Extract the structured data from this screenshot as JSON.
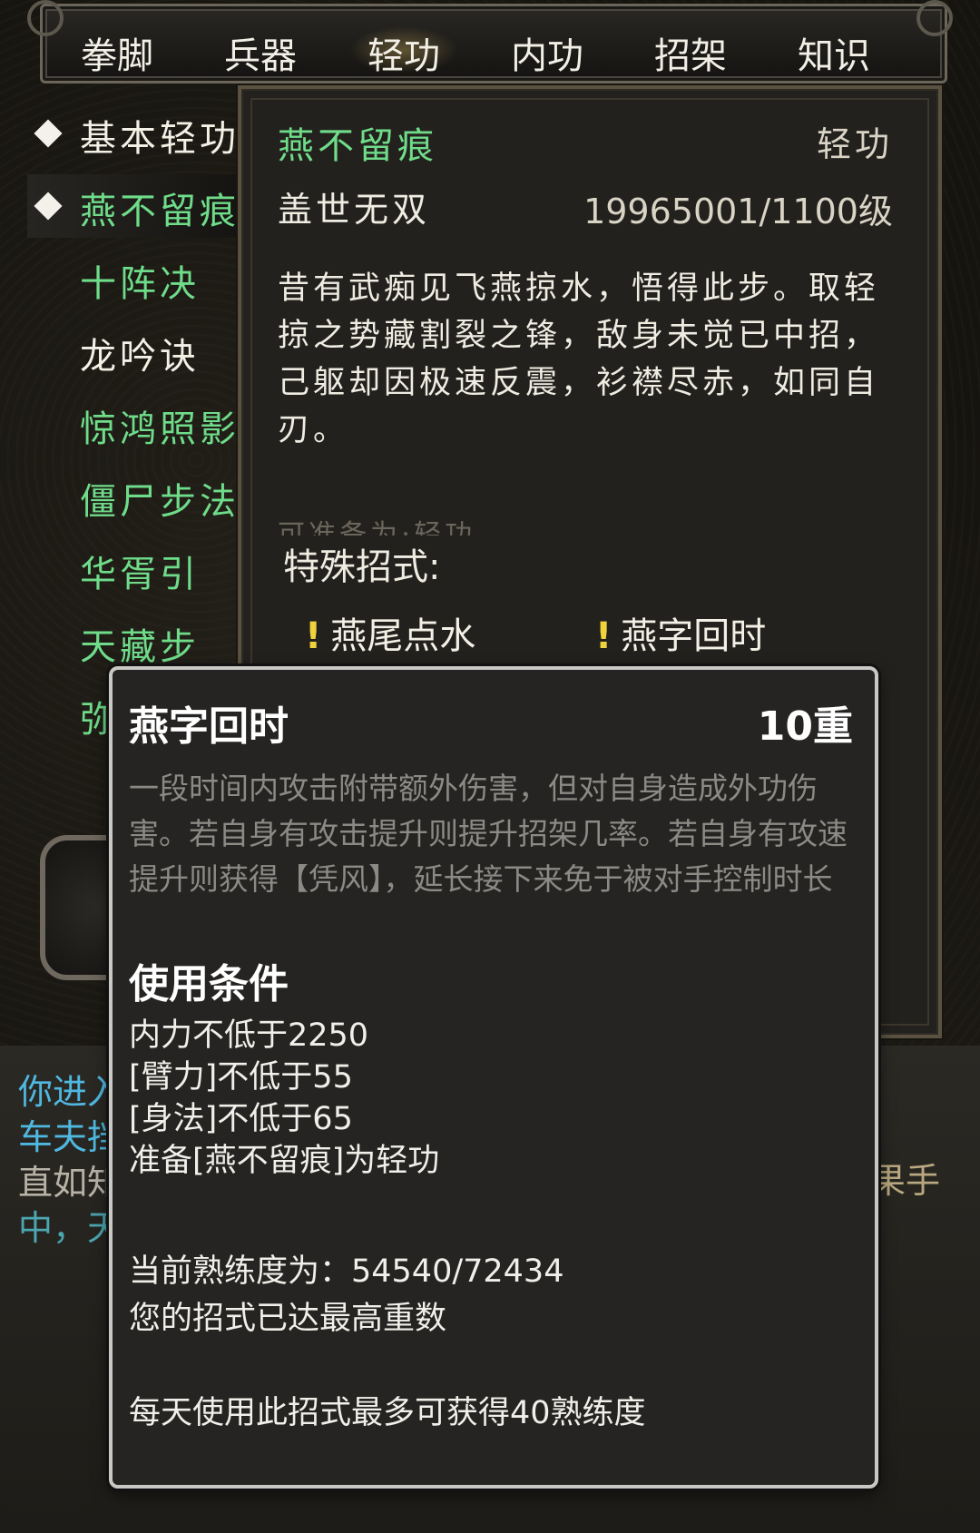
{
  "tabs": [
    {
      "label": "拳脚",
      "active": false
    },
    {
      "label": "兵器",
      "active": false
    },
    {
      "label": "轻功",
      "active": true
    },
    {
      "label": "内功",
      "active": false
    },
    {
      "label": "招架",
      "active": false
    },
    {
      "label": "知识",
      "active": false
    }
  ],
  "skill_list": [
    {
      "label": "基本轻功",
      "color": "#f3f0e6",
      "marked": true
    },
    {
      "label": "燕不留痕",
      "color": "#6fdc8a",
      "marked": true
    },
    {
      "label": "十阵决",
      "color": "#6fdc8a",
      "marked": false
    },
    {
      "label": "龙吟诀",
      "color": "#f3f0e6",
      "marked": false
    },
    {
      "label": "惊鸿照影",
      "color": "#6fdc8a",
      "marked": false
    },
    {
      "label": "僵尸步法",
      "color": "#6fdc8a",
      "marked": false
    },
    {
      "label": "华胥引",
      "color": "#6fdc8a",
      "marked": false
    },
    {
      "label": "天藏步",
      "color": "#6fdc8a",
      "marked": false
    },
    {
      "label": "弥",
      "color": "#6fdc8a",
      "marked": false
    }
  ],
  "detail": {
    "name": "燕不留痕",
    "type": "轻功",
    "rank": "盖世无双",
    "level": "19965001/1100级",
    "description": "昔有武痴见飞燕掠水，悟得此步。取轻掠之势藏割裂之锋，敌身未觉已中招，己躯却因极速反震，衫襟尽赤，如同自刃。",
    "faded_note": "可准备为:轻功",
    "special_title": "特殊招式:",
    "special_moves": [
      "燕尾点水",
      "燕字回时"
    ]
  },
  "log": {
    "line1": "你进入",
    "line2": "车夫挡",
    "line3": "直如知",
    "line4": "中，天",
    "right_fragment": "果手"
  },
  "popup": {
    "title": "燕字回时",
    "level": "10重",
    "description": "一段时间内攻击附带额外伤害，但对自身造成外功伤害。若自身有攻击提升则提升招架几率。若自身有攻速提升则获得【凭风】，延长接下来免于被对手控制时长",
    "conditions_title": "使用条件",
    "conditions": [
      "内力不低于2250",
      "[臂力]不低于55",
      "[身法]不低于65",
      "准备[燕不留痕]为轻功"
    ],
    "proficiency": "当前熟练度为：54540/72434",
    "max_note": "您的招式已达最高重数",
    "daily_note": "每天使用此招式最多可获得40熟练度"
  },
  "colors": {
    "accent_green": "#6fdc8a",
    "bang_yellow": "#f0d23c",
    "log_cyan": "#4fb8e0"
  }
}
